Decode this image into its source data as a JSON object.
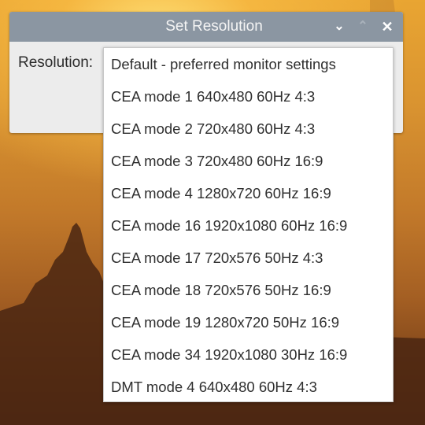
{
  "window": {
    "title": "Set Resolution",
    "buttons": {
      "minimize": "⌄",
      "maximize": "⌃",
      "close": "✕"
    }
  },
  "form": {
    "resolution_label": "Resolution:"
  },
  "dropdown": {
    "options": [
      "Default - preferred monitor settings",
      "CEA mode 1 640x480 60Hz 4:3",
      "CEA mode 2 720x480 60Hz 4:3",
      "CEA mode 3 720x480 60Hz 16:9",
      "CEA mode 4 1280x720 60Hz 16:9",
      "CEA mode 16 1920x1080 60Hz 16:9",
      "CEA mode 17 720x576 50Hz 4:3",
      "CEA mode 18 720x576 50Hz 16:9",
      "CEA mode 19 1280x720 50Hz 16:9",
      "CEA mode 34 1920x1080 30Hz 16:9",
      "DMT mode 4 640x480 60Hz 4:3"
    ]
  }
}
